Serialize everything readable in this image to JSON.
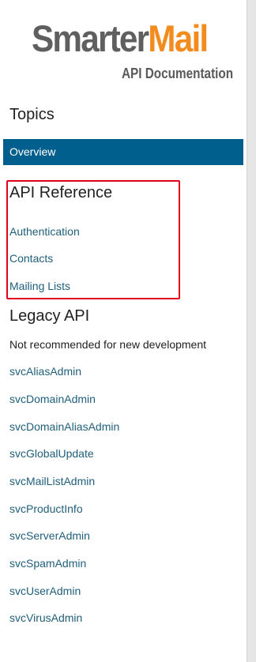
{
  "logo": {
    "brand_part1": "Smarter",
    "brand_part2": "Mail",
    "subtitle": "API Documentation"
  },
  "sidebar": {
    "topics_heading": "Topics",
    "overview_label": "Overview",
    "api_reference": {
      "heading": "API Reference",
      "items": [
        {
          "label": "Authentication"
        },
        {
          "label": "Contacts"
        },
        {
          "label": "Mailing Lists"
        }
      ]
    },
    "legacy_api": {
      "heading": "Legacy API",
      "note": "Not recommended for new development",
      "items": [
        {
          "label": "svcAliasAdmin"
        },
        {
          "label": "svcDomainAdmin"
        },
        {
          "label": "svcDomainAliasAdmin"
        },
        {
          "label": "svcGlobalUpdate"
        },
        {
          "label": "svcMailListAdmin"
        },
        {
          "label": "svcProductInfo"
        },
        {
          "label": "svcServerAdmin"
        },
        {
          "label": "svcSpamAdmin"
        },
        {
          "label": "svcUserAdmin"
        },
        {
          "label": "svcVirusAdmin"
        }
      ]
    }
  },
  "colors": {
    "brand_gray": "#5f5f5f",
    "brand_orange": "#f28c1f",
    "active_item_bg": "#005f8c",
    "link": "#1f5e7a",
    "highlight_border": "#e0001b"
  }
}
